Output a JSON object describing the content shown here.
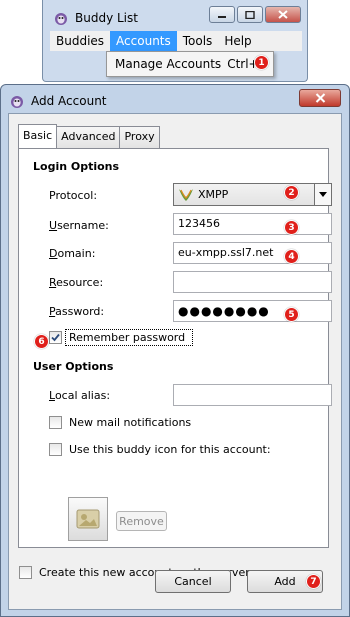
{
  "buddy_list": {
    "title": "Buddy List",
    "menu": [
      "Buddies",
      "Accounts",
      "Tools",
      "Help"
    ],
    "dropdown_item": "Manage Accounts",
    "dropdown_shortcut": "Ctrl+A"
  },
  "dialog": {
    "title": "Add Account",
    "tabs": [
      "Basic",
      "Advanced",
      "Proxy"
    ],
    "login_options": {
      "heading": "Login Options",
      "protocol_label": "Protocol:",
      "protocol_value": "XMPP",
      "username_label": "Username:",
      "username_value": "123456",
      "domain_label": "Domain:",
      "domain_value": "eu-xmpp.ssl7.net",
      "resource_label": "Resource:",
      "resource_value": "",
      "password_label": "Password:",
      "password_value": "●●●●●●●●",
      "remember_label": "Remember password",
      "remember_checked": true
    },
    "user_options": {
      "heading": "User Options",
      "alias_label": "Local alias:",
      "alias_value": "",
      "mail_label": "New mail notifications",
      "buddy_icon_label": "Use this buddy icon for this account:",
      "remove_label": "Remove"
    },
    "create_label": "Create this new account on the server",
    "cancel_label": "Cancel",
    "add_label": "Add"
  },
  "badges": [
    "1",
    "2",
    "3",
    "4",
    "5",
    "6",
    "7"
  ],
  "colors": {
    "badge_red": "#e0201b",
    "menu_highlight": "#3399ff",
    "window_frame": "#c2d3e8"
  }
}
